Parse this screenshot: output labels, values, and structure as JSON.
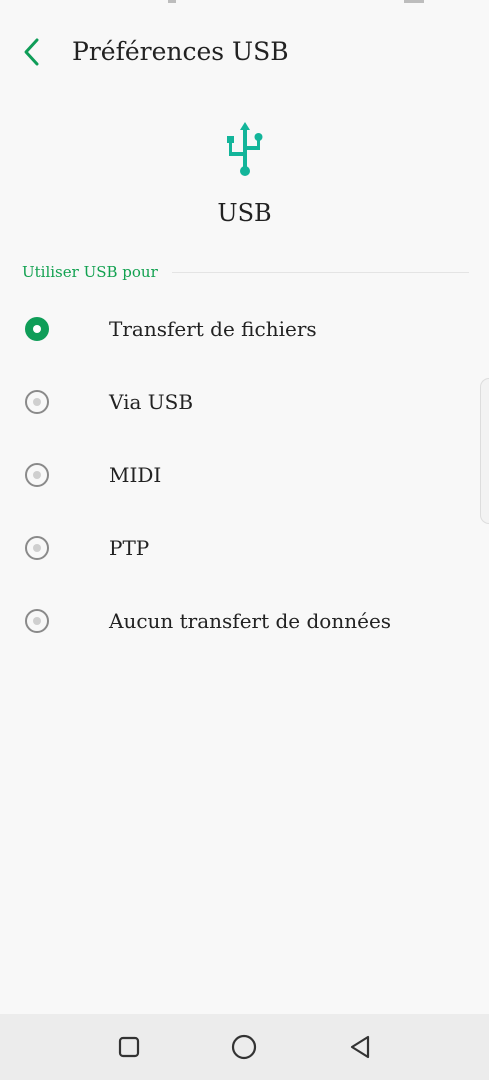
{
  "colors": {
    "accent": "#0f9d58",
    "icon_teal": "#13b59a",
    "background": "#f8f8f8",
    "nav_background": "#ececec"
  },
  "header": {
    "back_icon": "chevron-left-icon",
    "title": "Préférences USB"
  },
  "hero": {
    "icon": "usb-icon",
    "label": "USB"
  },
  "section": {
    "title": "Utiliser USB pour"
  },
  "options": [
    {
      "label": "Transfert de fichiers",
      "selected": true
    },
    {
      "label": "Via USB",
      "selected": false
    },
    {
      "label": "MIDI",
      "selected": false
    },
    {
      "label": "PTP",
      "selected": false
    },
    {
      "label": "Aucun transfert de données",
      "selected": false
    }
  ],
  "nav": {
    "recents_icon": "square-icon",
    "home_icon": "circle-icon",
    "back_icon": "triangle-back-icon"
  }
}
